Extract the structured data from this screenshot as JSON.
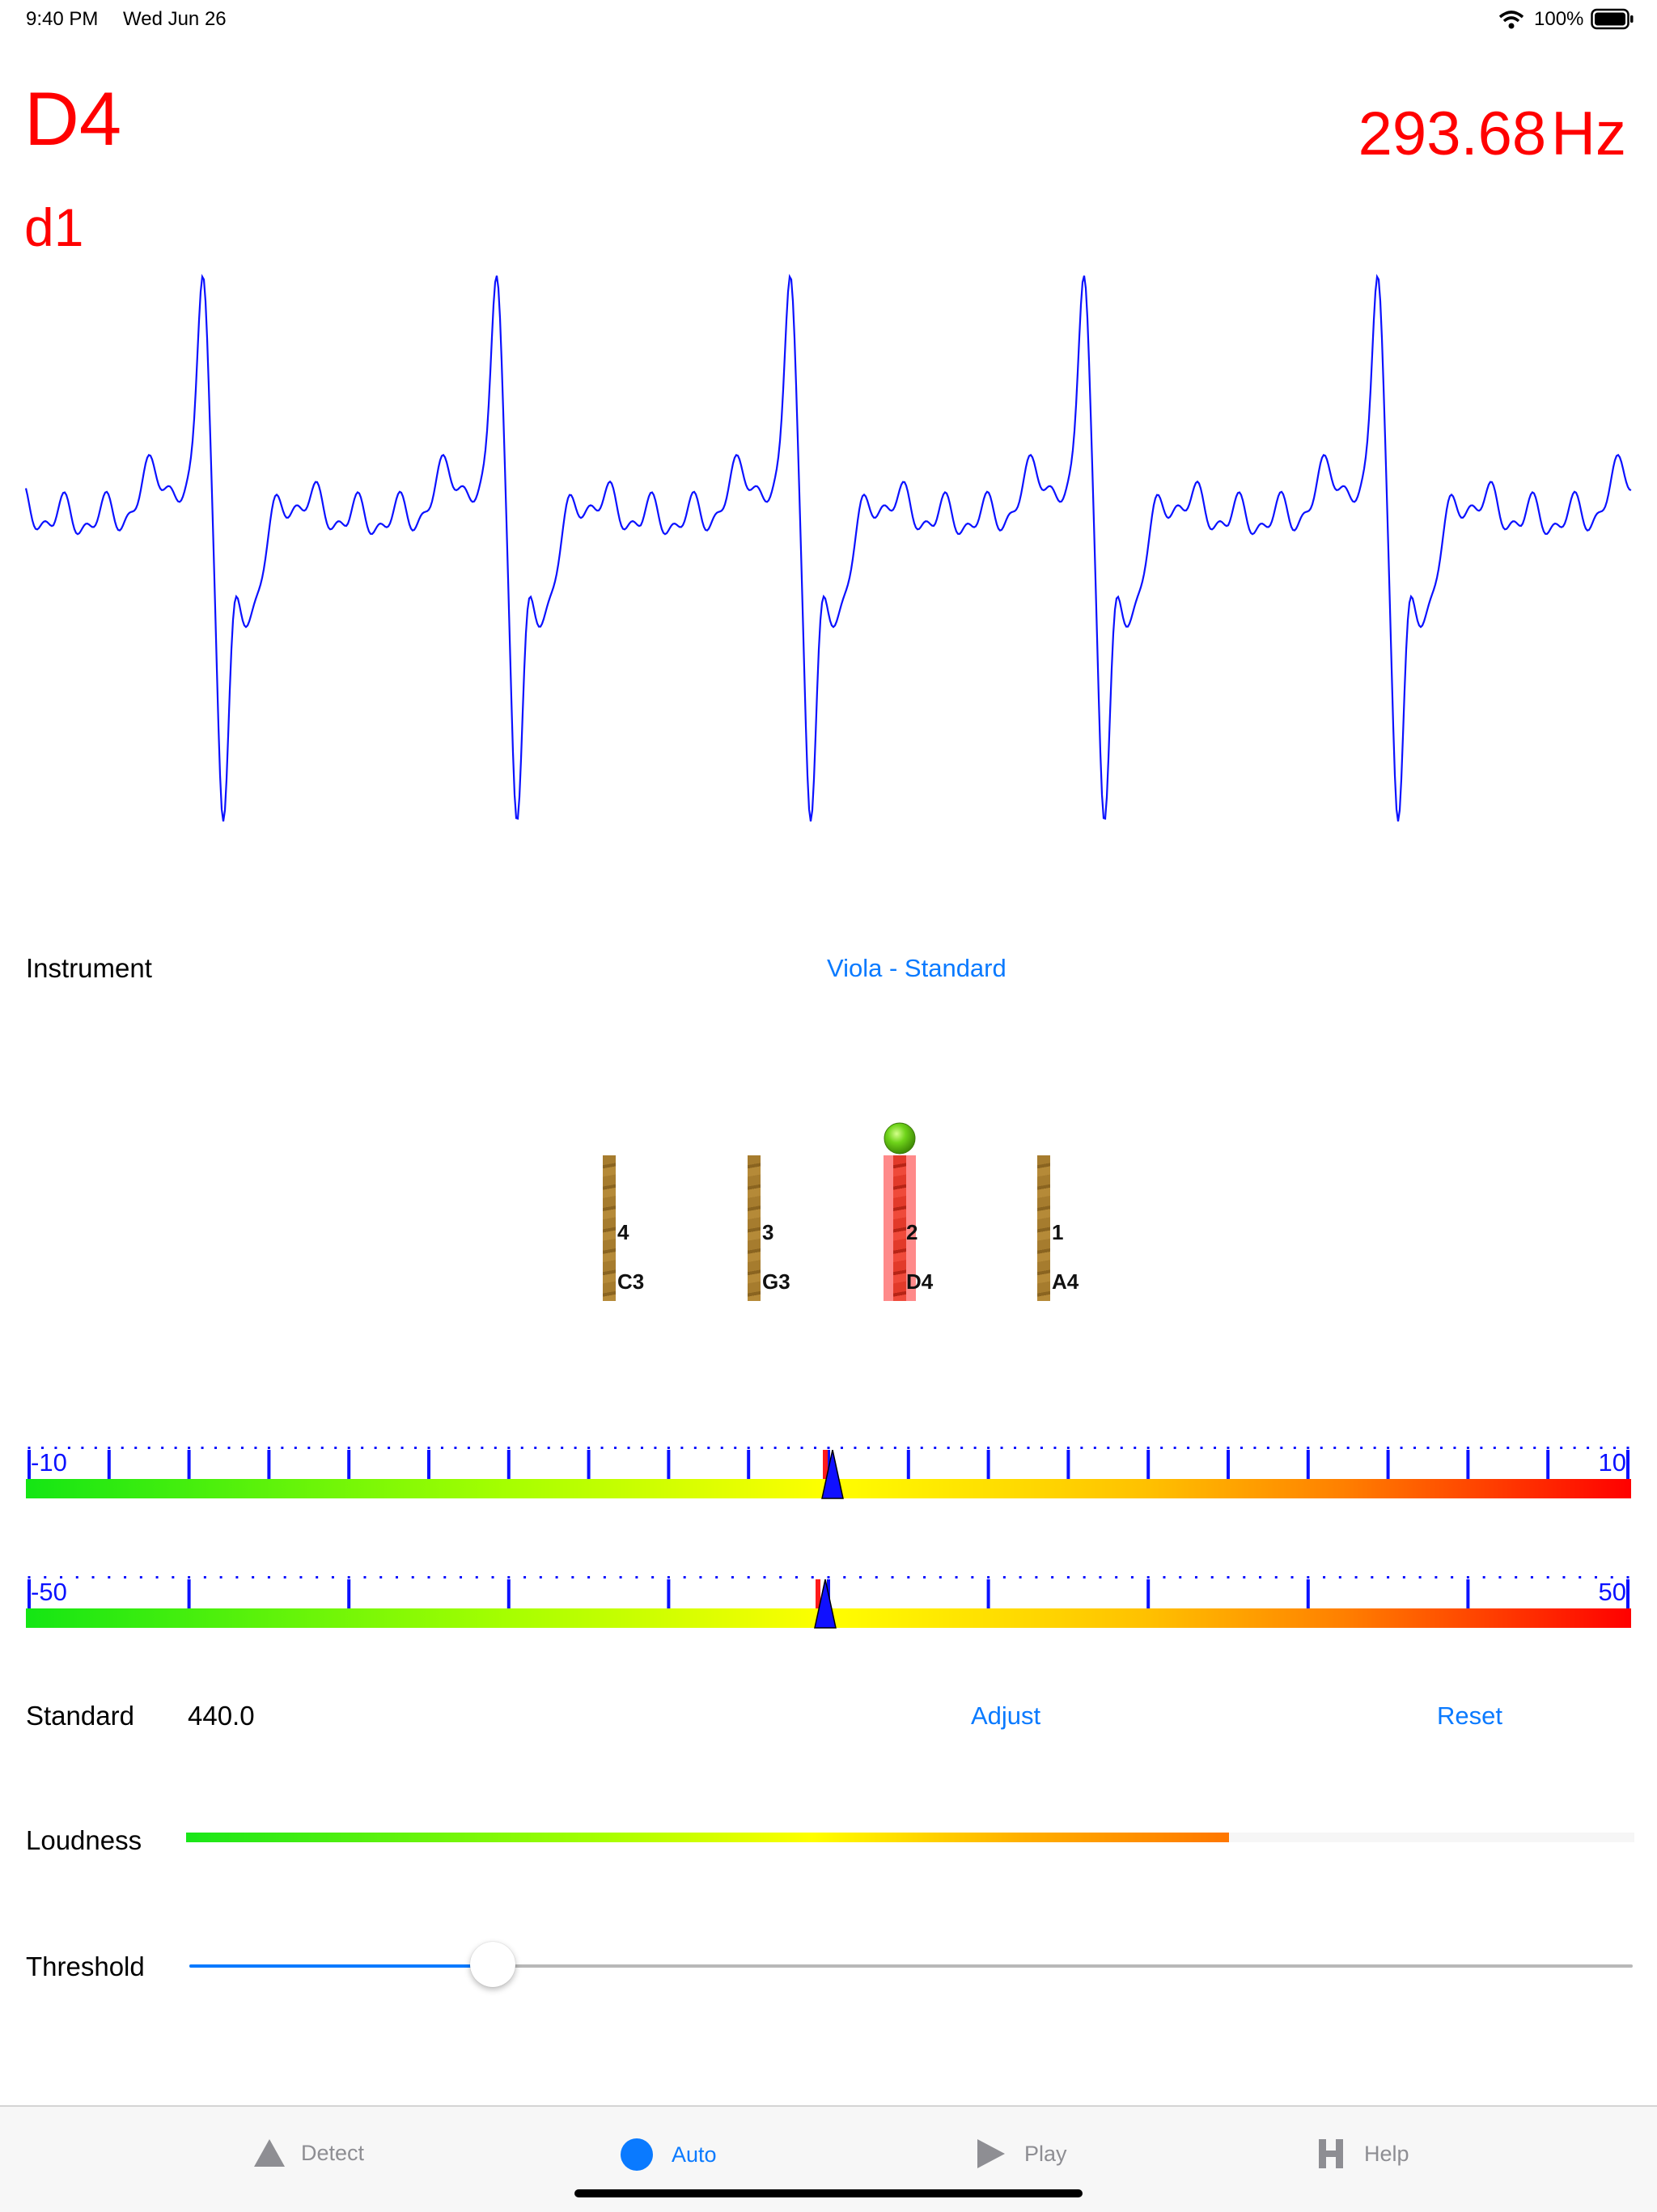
{
  "status_bar": {
    "time": "9:40 PM",
    "date": "Wed Jun 26",
    "battery": "100%",
    "icons": [
      "wifi-icon",
      "battery-icon"
    ]
  },
  "tuner": {
    "note": "D4",
    "string_label": "d1",
    "frequency": "293.68",
    "frequency_unit": "Hz",
    "note_color": "#ff0000",
    "wave_color": "#0b11ff"
  },
  "instrument": {
    "label": "Instrument",
    "value": "Viola - Standard"
  },
  "strings": [
    {
      "number": "4",
      "note": "C3",
      "active": false
    },
    {
      "number": "3",
      "note": "G3",
      "active": false
    },
    {
      "number": "2",
      "note": "D4",
      "active": true
    },
    {
      "number": "1",
      "note": "A4",
      "active": false
    }
  ],
  "fine_scale": {
    "min_label": "-10",
    "max_label": "10",
    "min": -10,
    "max": 10,
    "value": 0.05
  },
  "coarse_scale": {
    "min_label": "-50",
    "max_label": "50",
    "min": -50,
    "max": 50,
    "value": -0.2
  },
  "standard": {
    "label": "Standard",
    "value": "440.0",
    "adjust_label": "Adjust",
    "reset_label": "Reset"
  },
  "loudness": {
    "label": "Loudness",
    "level": 0.72
  },
  "threshold": {
    "label": "Threshold",
    "value": 0.21
  },
  "tabs": [
    {
      "label": "Detect",
      "icon": "triangle-icon",
      "active": false
    },
    {
      "label": "Auto",
      "icon": "circle-icon",
      "active": true
    },
    {
      "label": "Play",
      "icon": "play-icon",
      "active": false
    },
    {
      "label": "Help",
      "icon": "h-letter-icon",
      "active": false
    }
  ],
  "colors": {
    "accent": "#0a7aff",
    "tab_inactive": "#8e8e93",
    "string_wood": "#a67c2e",
    "active_string": "#ff6a6a"
  }
}
